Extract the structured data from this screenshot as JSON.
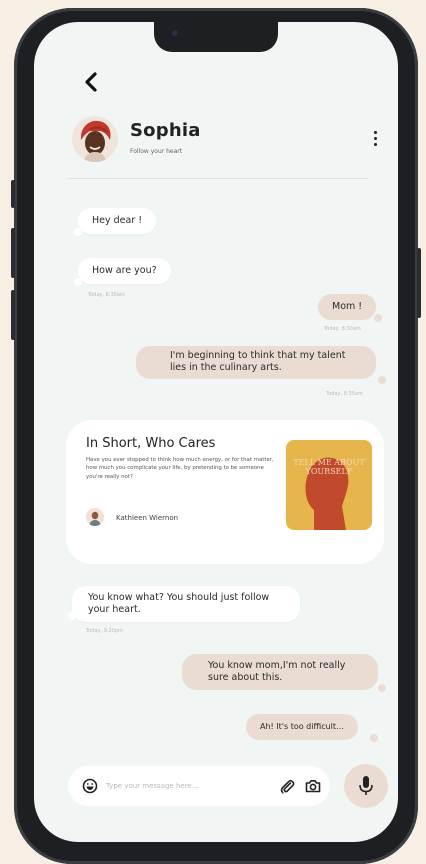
{
  "contact": {
    "name": "Sophia",
    "status": "Follow your heart"
  },
  "messages": [
    {
      "text": "Hey dear !"
    },
    {
      "text": "How are you?",
      "time": "Today, 8:30am"
    },
    {
      "text": "Mom !",
      "time": "Today, 8:30am"
    },
    {
      "text": "I'm beginning to think that my talent lies in the culinary arts.",
      "time": "Today, 8:35am"
    },
    {
      "text": "You know what? You should just follow your heart.",
      "time": "Today, 9:20pm"
    },
    {
      "text": "You know mom,I'm not really sure about this."
    },
    {
      "text": "Ah! It's too difficult..."
    }
  ],
  "card": {
    "title": "In Short, Who Cares",
    "text": "Have you ever stopped to think how much energy, or for that matter, how much you complicate your life, by pretending to be someone you're really not?",
    "author": "Kathleen Wiernon",
    "book_cover": "TELL ME ABOUT YOURSELF",
    "book_color": "#e6b64c"
  },
  "composer": {
    "placeholder": "Type your message here..."
  },
  "colors": {
    "outgoing": "#eadcd2",
    "incoming": "#ffffff",
    "background": "#f1f5f4"
  },
  "icons": [
    "back-arrow-icon",
    "more-vertical-icon",
    "emoji-icon",
    "paperclip-icon",
    "camera-icon",
    "microphone-icon"
  ]
}
